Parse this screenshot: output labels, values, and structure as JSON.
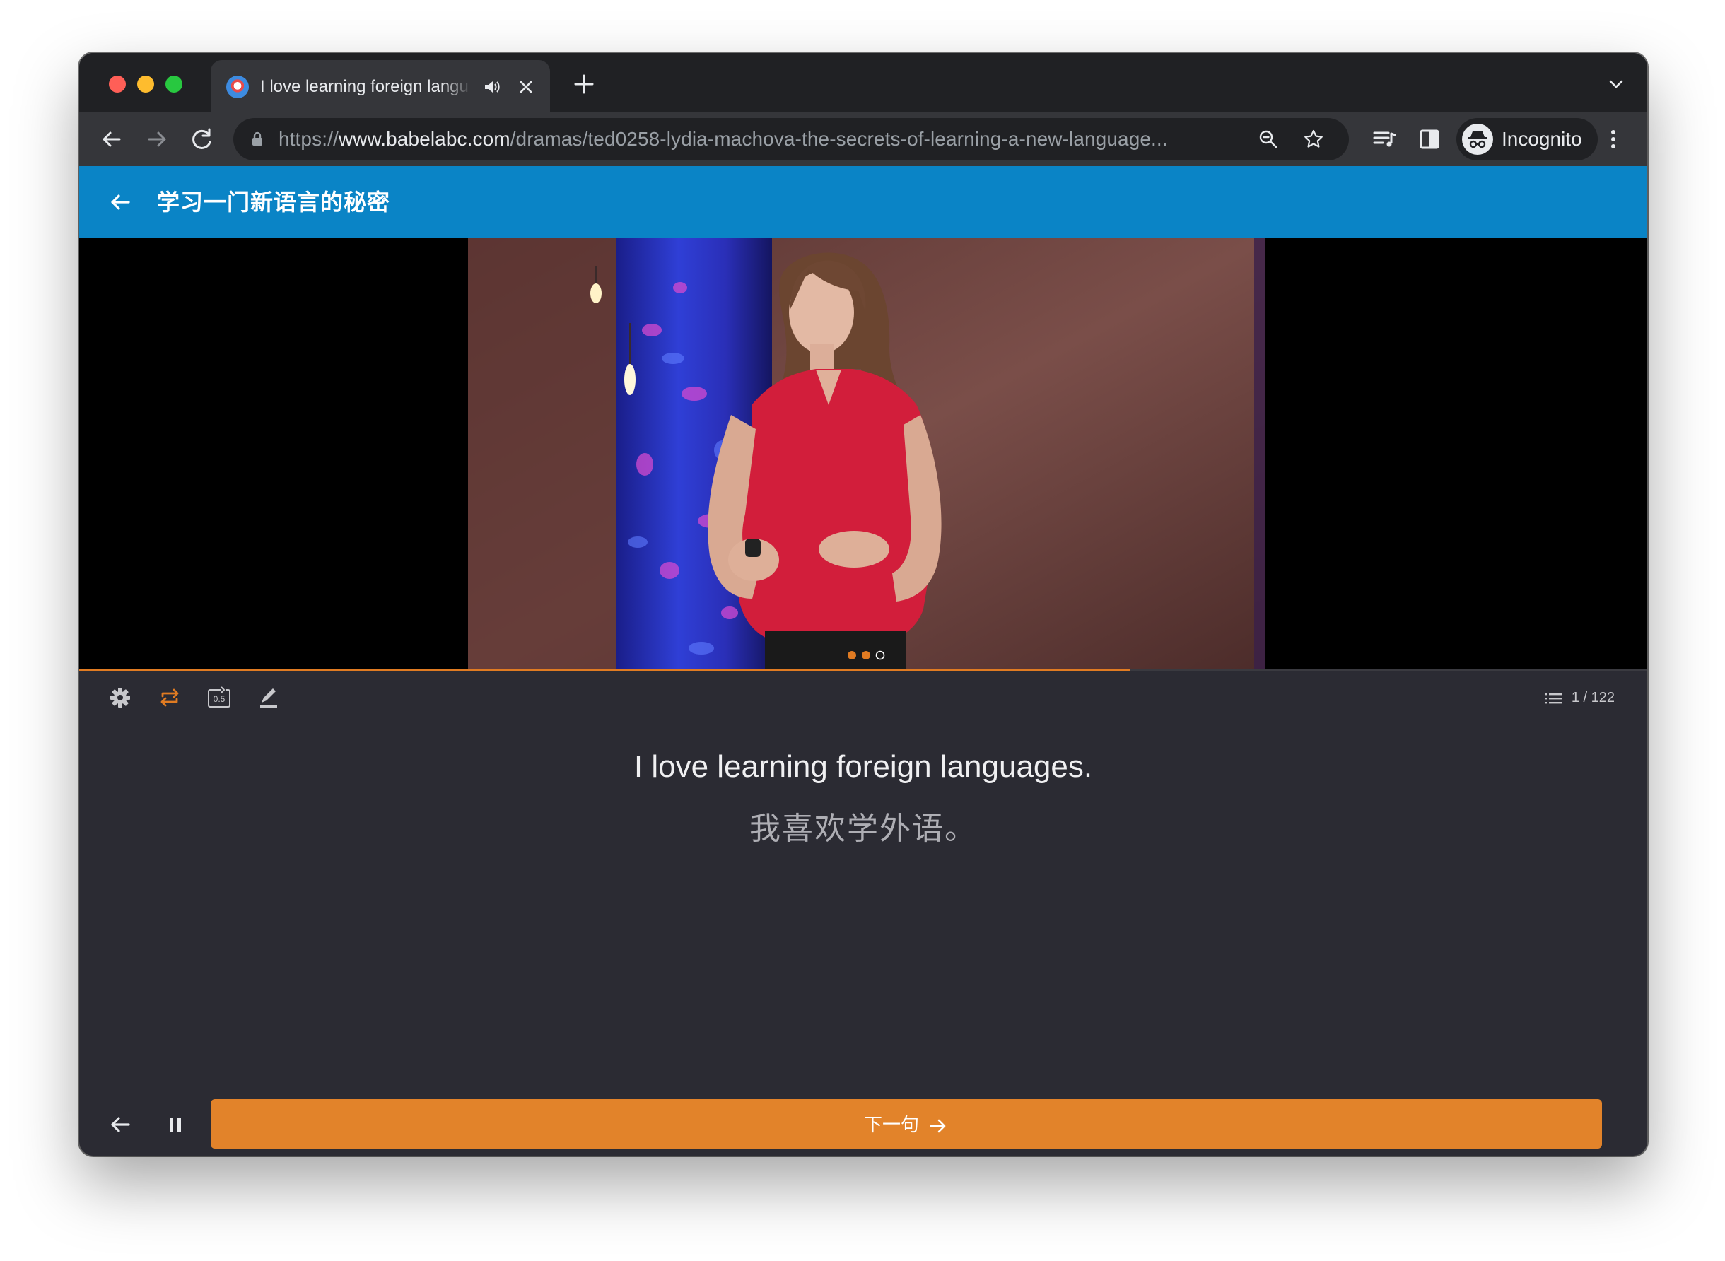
{
  "browser": {
    "tab_title": "I love learning foreign langu",
    "url_scheme": "https://",
    "url_host": "www.babelabc.com",
    "url_path": "/dramas/ted0258-lydia-machova-the-secrets-of-learning-a-new-language...",
    "profile_label": "Incognito"
  },
  "app": {
    "header_title": "学习一门新语言的秘密",
    "accent_color": "#0a84c6",
    "action_color": "#e2832a"
  },
  "player": {
    "progress_fraction": 0.67,
    "carousel_dots": 3,
    "carousel_active": 2,
    "speed_label": "0.5"
  },
  "sentence": {
    "counter": "1 / 122",
    "english": "I love learning foreign languages.",
    "chinese": "我喜欢学外语。"
  },
  "bottom": {
    "next_label": "下一句"
  },
  "icons": [
    "back-icon",
    "forward-icon",
    "reload-icon",
    "lock-icon",
    "zoom-icon",
    "star-icon",
    "media-icon",
    "sidepanel-icon",
    "incognito-icon",
    "kebab-icon",
    "settings-icon",
    "repeat-icon",
    "speed-icon",
    "edit-icon",
    "list-icon",
    "pause-icon",
    "arrow-right-icon"
  ]
}
